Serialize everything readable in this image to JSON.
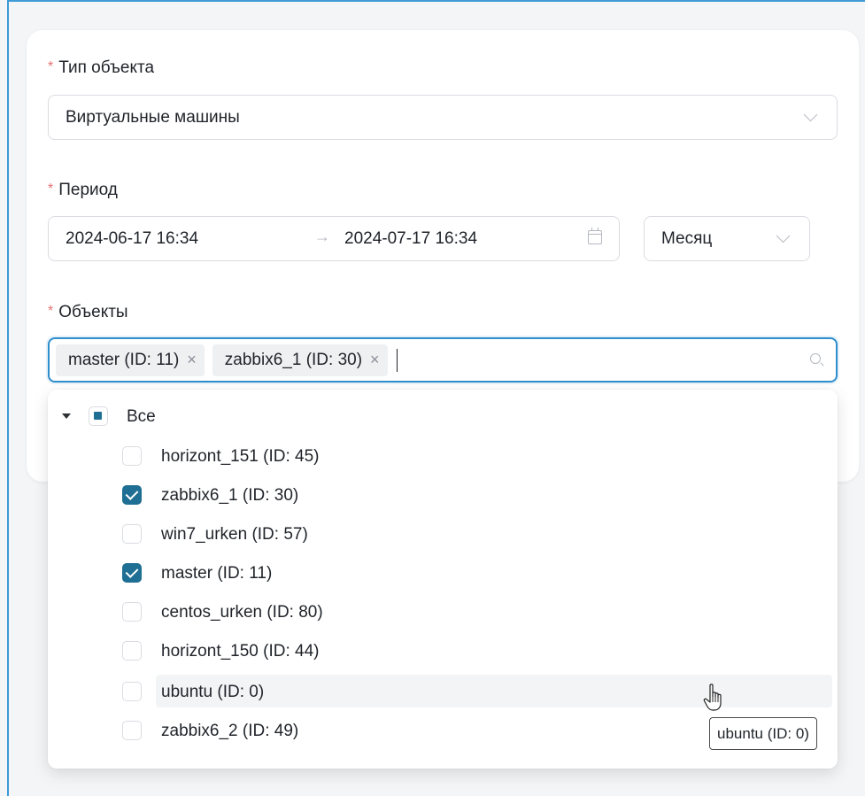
{
  "form": {
    "object_type": {
      "label": "Тип объекта",
      "value": "Виртуальные машины"
    },
    "period": {
      "label": "Период",
      "start": "2024-06-17 16:34",
      "arrow": "→",
      "end": "2024-07-17 16:34",
      "granularity": "Месяц"
    },
    "objects": {
      "label": "Объекты",
      "tags": [
        {
          "label": "master (ID: 11)",
          "remove": "×"
        },
        {
          "label": "zabbix6_1 (ID: 30)",
          "remove": "×"
        }
      ]
    },
    "required_mark": "*"
  },
  "dropdown": {
    "root_label": "Все",
    "items": [
      {
        "label": "horizont_151 (ID: 45)",
        "checked": false
      },
      {
        "label": "zabbix6_1 (ID: 30)",
        "checked": true
      },
      {
        "label": "win7_urken (ID: 57)",
        "checked": false
      },
      {
        "label": "master (ID: 11)",
        "checked": true
      },
      {
        "label": "centos_urken (ID: 80)",
        "checked": false
      },
      {
        "label": "horizont_150 (ID: 44)",
        "checked": false
      },
      {
        "label": "ubuntu (ID: 0)",
        "checked": false,
        "hovered": true
      },
      {
        "label": "zabbix6_2 (ID: 49)",
        "checked": false
      }
    ]
  },
  "tooltip": {
    "text": "ubuntu (ID: 0)"
  },
  "colors": {
    "accent": "#1f6e93",
    "focus_border": "#2f8ecb",
    "required": "#e57373"
  }
}
